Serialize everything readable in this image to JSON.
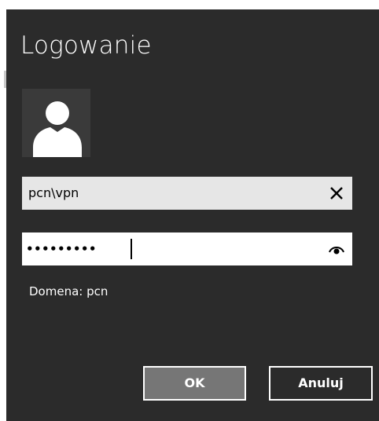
{
  "dialog": {
    "title": "Logowanie",
    "background_color": "#2b2b2b"
  },
  "avatar": {
    "icon": "user-silhouette-icon"
  },
  "username": {
    "value": "pcn\\vpn",
    "clear_icon": "close-icon"
  },
  "password": {
    "masked_value": "•••••••••",
    "reveal_icon": "eye-icon"
  },
  "domain": {
    "text": "Domena: pcn"
  },
  "buttons": {
    "ok_label": "OK",
    "cancel_label": "Anuluj",
    "ok_color": "#767676"
  }
}
